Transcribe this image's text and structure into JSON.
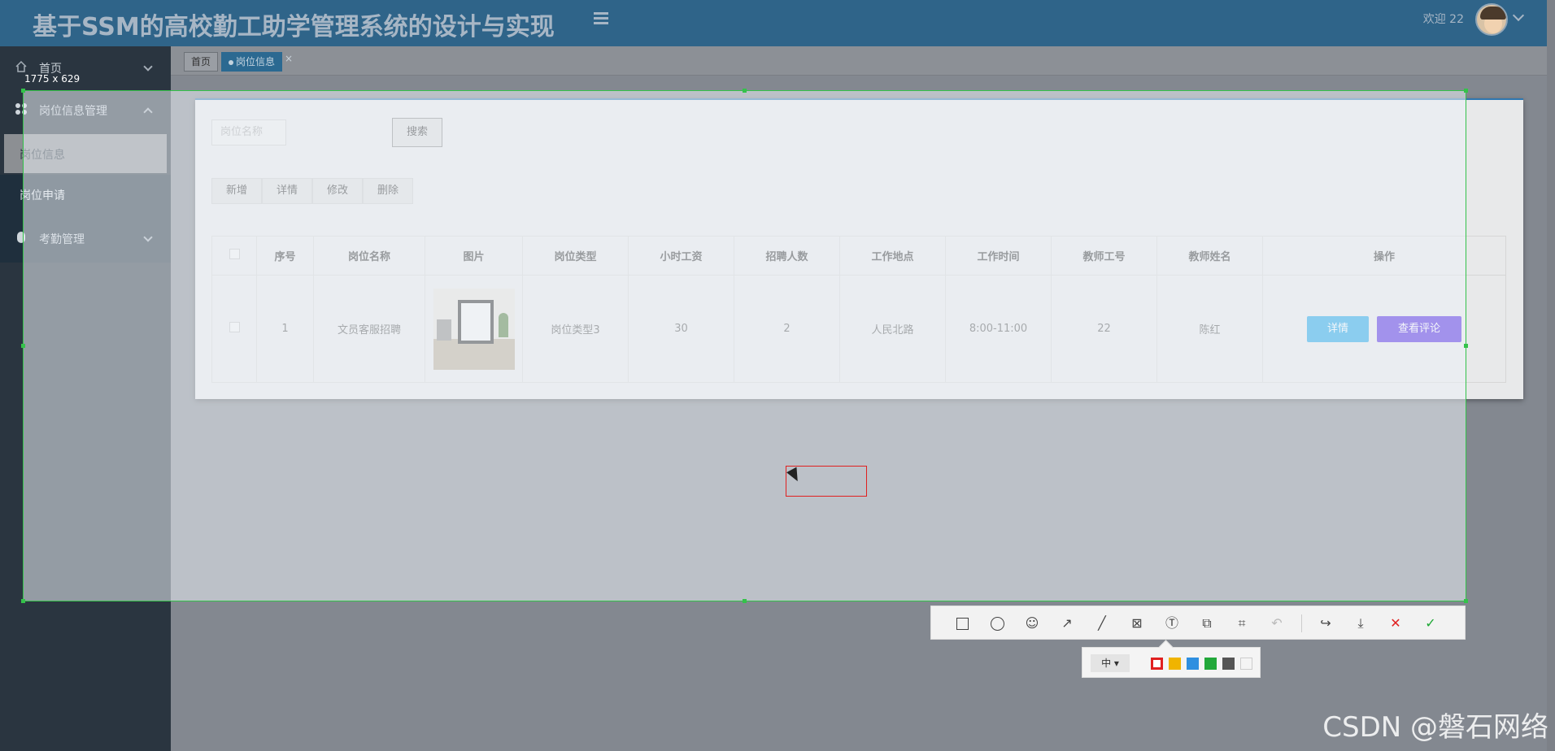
{
  "header": {
    "title": "基于SSM的高校勤工助学管理系统的设计与实现",
    "welcome": "欢迎 22"
  },
  "sidebar": {
    "items": [
      {
        "label": "首页"
      },
      {
        "label": "岗位信息管理"
      },
      {
        "label": "考勤管理"
      }
    ],
    "sub_items": [
      {
        "label": "岗位信息"
      },
      {
        "label": "岗位申请"
      }
    ]
  },
  "tabs": [
    {
      "label": "首页"
    },
    {
      "label": "岗位信息",
      "close": "×"
    }
  ],
  "search": {
    "placeholder": "岗位名称",
    "button": "搜索"
  },
  "actions": [
    "新增",
    "详情",
    "修改",
    "删除"
  ],
  "table": {
    "columns": [
      "序号",
      "岗位名称",
      "图片",
      "岗位类型",
      "小时工资",
      "招聘人数",
      "工作地点",
      "工作时间",
      "教师工号",
      "教师姓名",
      "操作"
    ],
    "rows": [
      {
        "index": "1",
        "name": "文员客服招聘",
        "type": "岗位类型3",
        "wage": "30",
        "count": "2",
        "location": "人民北路",
        "time": "8:00-11:00",
        "teacher_id": "22",
        "teacher_name": "陈红",
        "btn_detail": "详情",
        "btn_review": "查看评论"
      }
    ]
  },
  "overlay": {
    "selection_size": "1775 x 629",
    "size_option": "中 ▾",
    "colors": [
      "#e02020",
      "#f0b400",
      "#2f8fe0",
      "#22a83a",
      "#555555",
      "#f4f4f4"
    ]
  },
  "watermark": "CSDN @磐石网络"
}
